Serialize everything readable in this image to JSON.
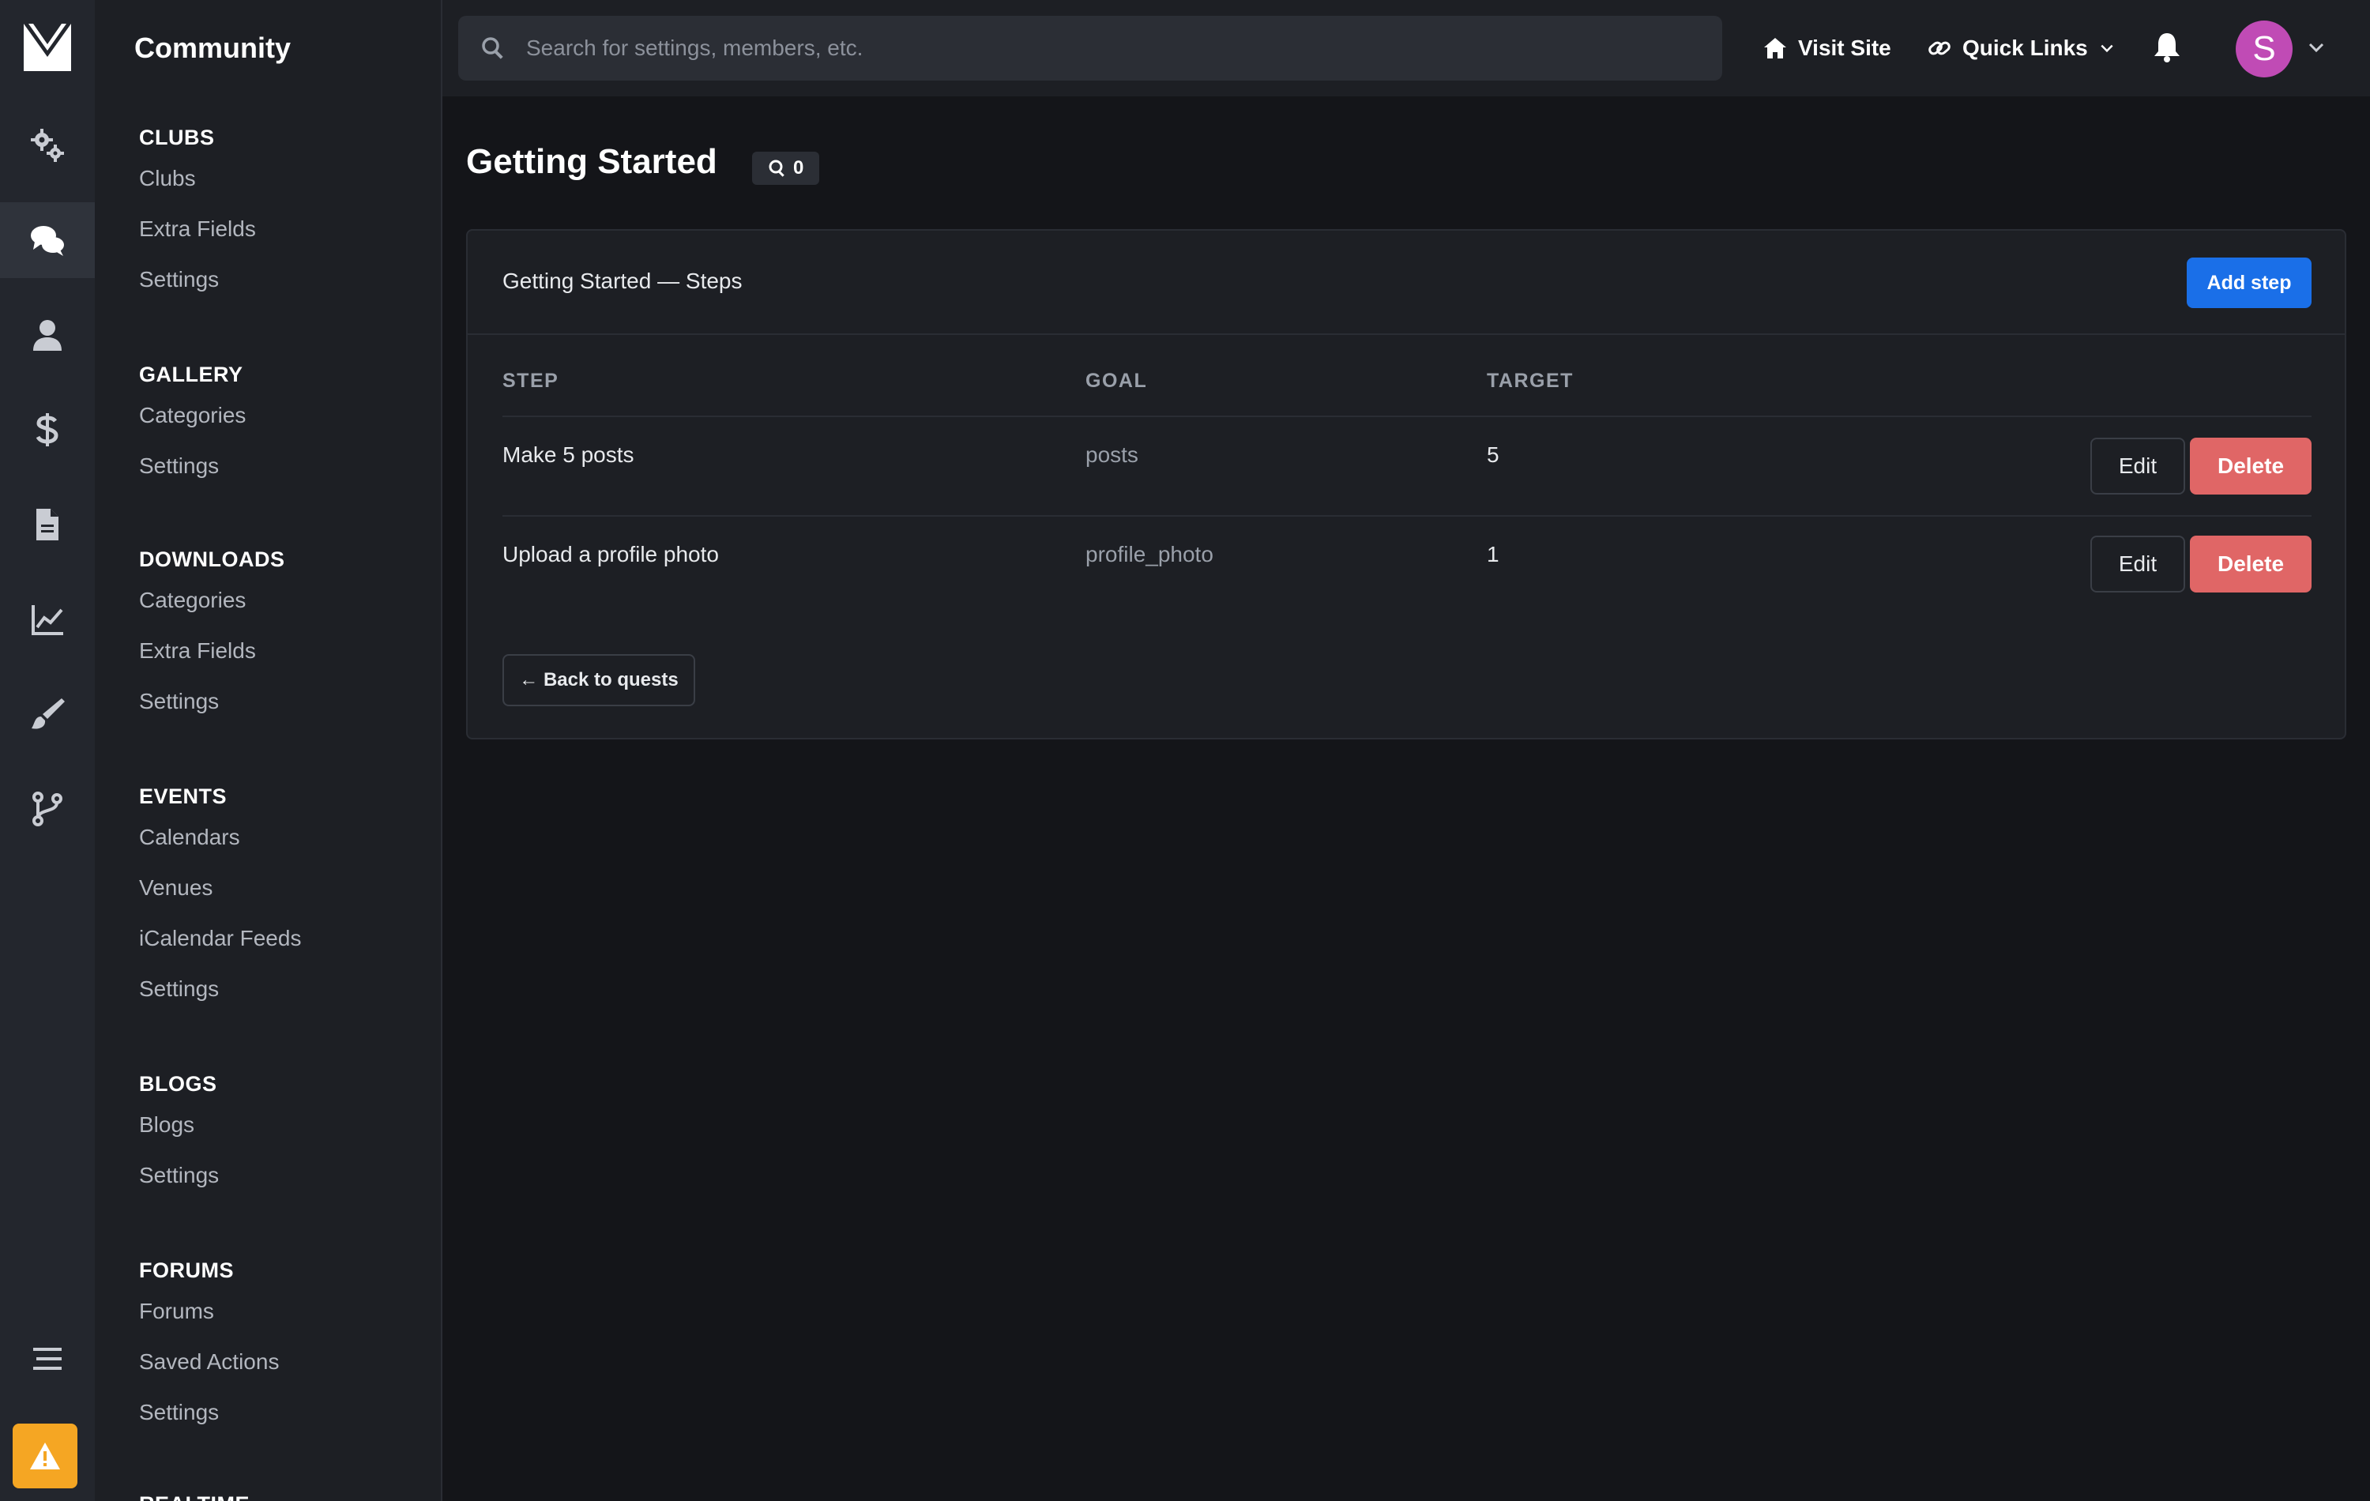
{
  "colors": {
    "accent": "#1a6fe8",
    "danger": "#e06666",
    "warning": "#f5a623",
    "avatar": "#c04bb5",
    "background": "#141519",
    "panel": "#1d1f24"
  },
  "rail": {
    "logo_icon": "brand-logo",
    "items": [
      {
        "icon": "gears-icon"
      },
      {
        "icon": "chat-bubbles-icon",
        "active": true
      },
      {
        "icon": "user-icon"
      },
      {
        "icon": "dollar-icon"
      },
      {
        "icon": "file-icon"
      },
      {
        "icon": "chart-line-icon"
      },
      {
        "icon": "brush-icon"
      },
      {
        "icon": "code-branch-icon"
      }
    ],
    "menu_icon": "hamburger-icon",
    "warning_icon": "warning-icon"
  },
  "subnav": {
    "title": "Community",
    "sections": [
      {
        "heading": "CLUBS",
        "items": [
          "Clubs",
          "Extra Fields",
          "Settings"
        ]
      },
      {
        "heading": "GALLERY",
        "items": [
          "Categories",
          "Settings"
        ]
      },
      {
        "heading": "DOWNLOADS",
        "items": [
          "Categories",
          "Extra Fields",
          "Settings"
        ]
      },
      {
        "heading": "EVENTS",
        "items": [
          "Calendars",
          "Venues",
          "iCalendar Feeds",
          "Settings"
        ]
      },
      {
        "heading": "BLOGS",
        "items": [
          "Blogs",
          "Settings"
        ]
      },
      {
        "heading": "FORUMS",
        "items": [
          "Forums",
          "Saved Actions",
          "Settings"
        ]
      },
      {
        "heading": "REALTIME",
        "items": []
      }
    ]
  },
  "topbar": {
    "search_placeholder": "Search for settings, members, etc.",
    "visit_site": "Visit Site",
    "quick_links": "Quick Links",
    "avatar_letter": "S"
  },
  "page": {
    "title": "Getting Started",
    "badge_count": "0"
  },
  "card": {
    "title": "Getting Started — Steps",
    "add_button": "Add step",
    "columns": [
      "STEP",
      "GOAL",
      "TARGET"
    ],
    "rows": [
      {
        "step": "Make 5 posts",
        "goal": "posts",
        "target": "5"
      },
      {
        "step": "Upload a profile photo",
        "goal": "profile_photo",
        "target": "1"
      }
    ],
    "edit_label": "Edit",
    "delete_label": "Delete",
    "back_label": "← Back to quests"
  }
}
